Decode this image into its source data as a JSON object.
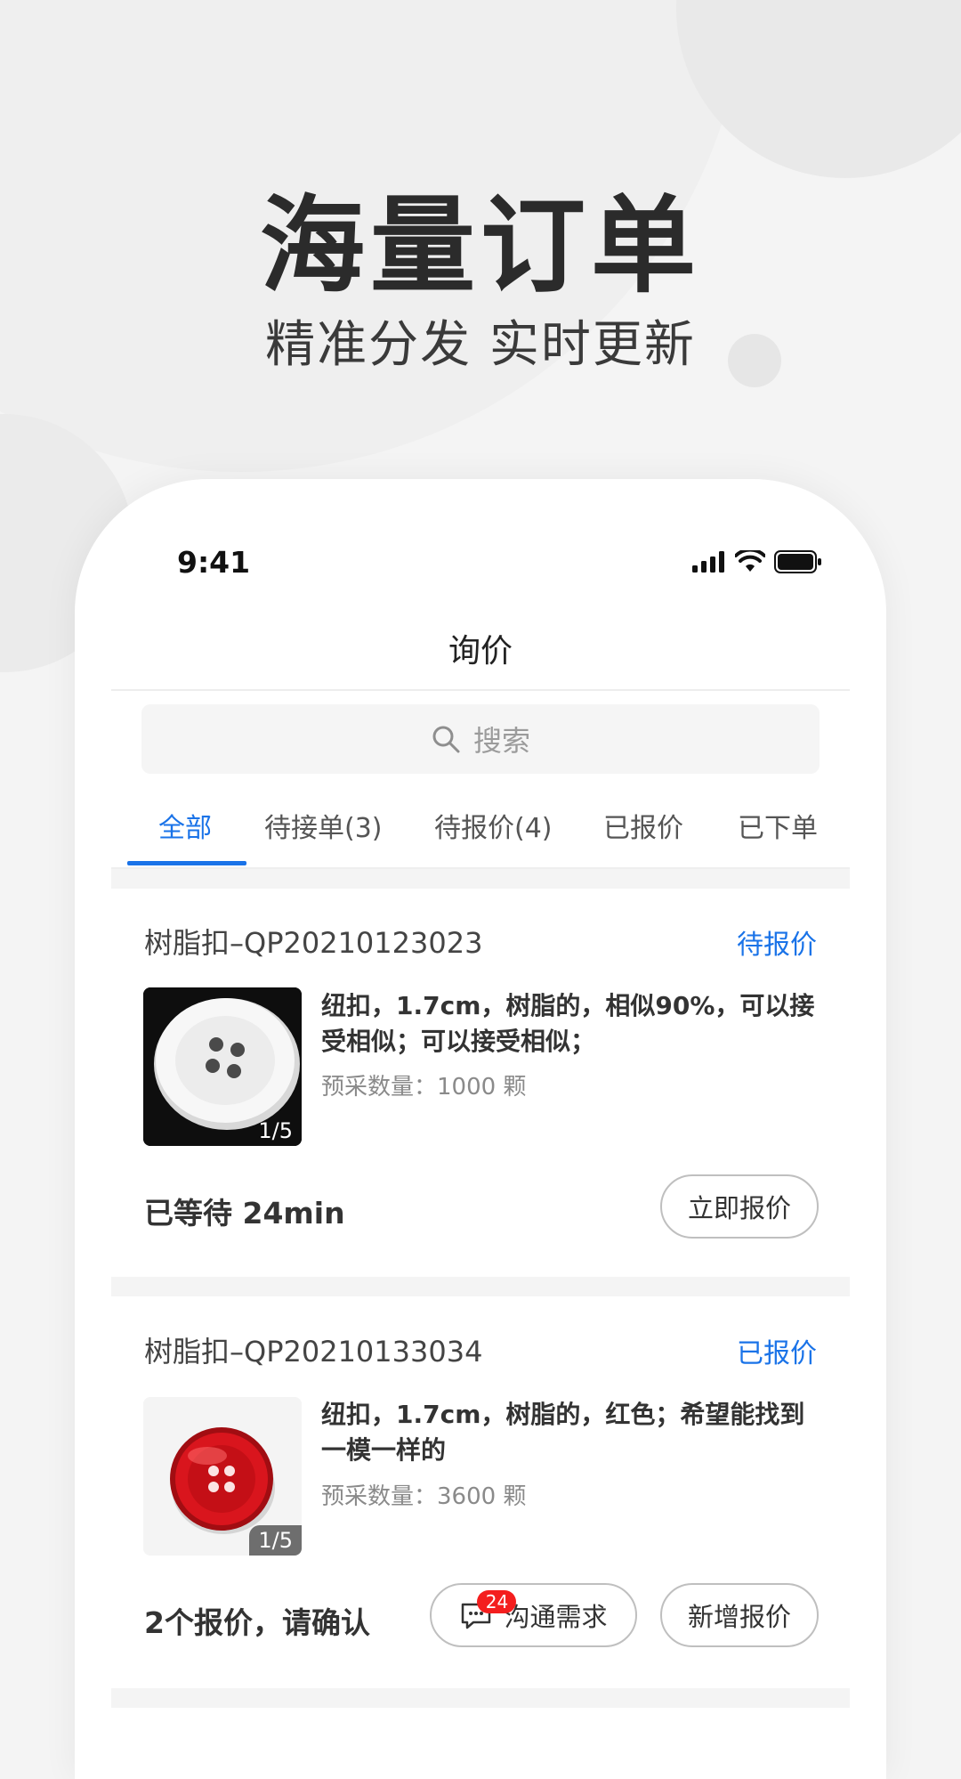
{
  "hero": {
    "title": "海量订单",
    "subtitle": "精准分发 实时更新"
  },
  "status_bar": {
    "time": "9:41",
    "icons": [
      "signal-icon",
      "wifi-icon",
      "battery-icon"
    ]
  },
  "nav": {
    "title": "询价"
  },
  "search": {
    "placeholder": "搜索",
    "icon": "search-icon"
  },
  "tabs": [
    {
      "label": "全部",
      "active": true
    },
    {
      "label": "待接单(3)",
      "active": false
    },
    {
      "label": "待报价(4)",
      "active": false
    },
    {
      "label": "已报价",
      "active": false
    },
    {
      "label": "已下单",
      "active": false
    }
  ],
  "orders": [
    {
      "title": "树脂扣–QP20210123023",
      "status": "待报价",
      "description": "纽扣，1.7cm，树脂的，相似90%，可以接受相似；可以接受相似；",
      "quantity": "预采数量：1000 颗",
      "image_counter": "1/5",
      "image_icon": "white-button-image",
      "footer_text": "已等待 24min",
      "action_label": "立即报价"
    },
    {
      "title": "树脂扣–QP20210133034",
      "status": "已报价",
      "description": "纽扣，1.7cm，树脂的，红色；希望能找到一模一样的",
      "quantity": "预采数量：3600 颗",
      "image_counter": "1/5",
      "image_icon": "red-button-image",
      "footer_text": "2个报价，请确认",
      "chat_label": "沟通需求",
      "chat_badge": "24",
      "action_label": "新增报价"
    }
  ],
  "colors": {
    "accent": "#1a73e8",
    "badge": "#f41e1e",
    "background": "#f4f4f4"
  }
}
